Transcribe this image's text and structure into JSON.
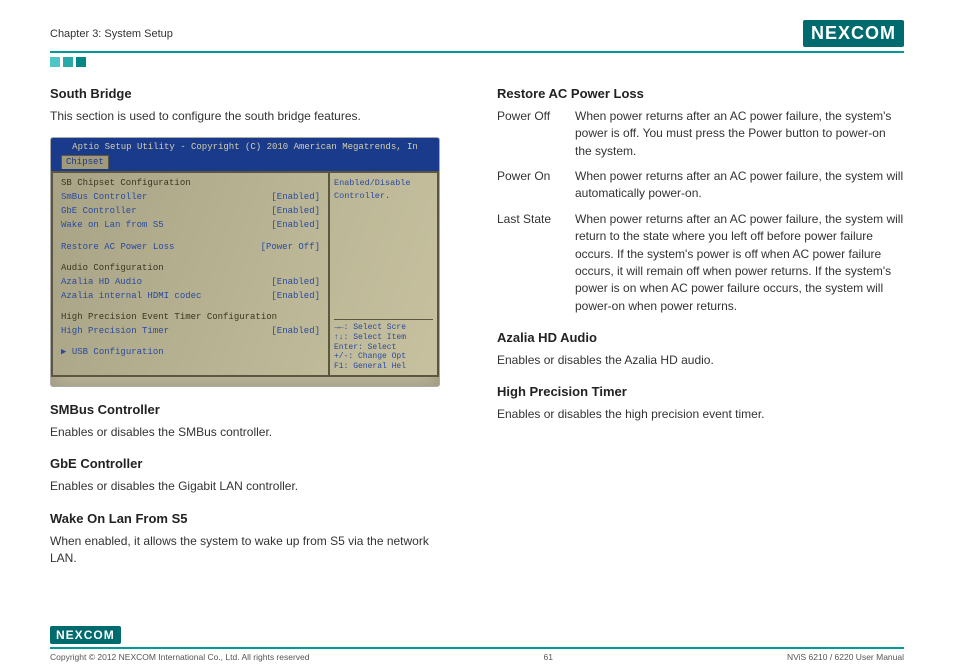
{
  "header": {
    "chapter": "Chapter 3: System Setup",
    "logo_text": "NEXCOM"
  },
  "left": {
    "south_bridge_head": "South Bridge",
    "south_bridge_desc": "This section is used to configure the south bridge features.",
    "smbus_head": "SMBus Controller",
    "smbus_desc": "Enables or disables the SMBus controller.",
    "gbe_head": "GbE Controller",
    "gbe_desc": "Enables or disables the Gigabit LAN controller.",
    "wol_head": "Wake On Lan From S5",
    "wol_desc": "When enabled, it allows the system to wake up from S5 via the network LAN."
  },
  "right": {
    "restore_head": "Restore AC Power Loss",
    "restore_rows": [
      {
        "term": "Power Off",
        "desc": "When power returns after an AC power failure, the system's power is off. You must press the Power button to power-on the system."
      },
      {
        "term": "Power On",
        "desc": "When power returns after an AC power failure, the system will automatically power-on."
      },
      {
        "term": "Last State",
        "desc": "When power returns after an AC power failure, the system will return to the state where you left off before power failure occurs. If the system's power is off when AC power failure occurs, it will remain off when power returns. If the system's power is on when AC power failure occurs, the system will power-on when power returns."
      }
    ],
    "azalia_head": "Azalia HD Audio",
    "azalia_desc": "Enables or disables the Azalia HD audio.",
    "hpet_head": "High Precision Timer",
    "hpet_desc": "Enables or disables the high precision event timer."
  },
  "bios": {
    "title": "Aptio Setup Utility - Copyright (C) 2010 American Megatrends, In",
    "tab": "Chipset",
    "section1": "SB Chipset Configuration",
    "rows1": [
      {
        "label": "SmBus Controller",
        "value": "[Enabled]"
      },
      {
        "label": "GbE Controller",
        "value": "[Enabled]"
      },
      {
        "label": "Wake on Lan from S5",
        "value": "[Enabled]"
      }
    ],
    "rows2": [
      {
        "label": "Restore AC Power Loss",
        "value": "[Power Off]"
      }
    ],
    "section2": "Audio Configuration",
    "rows3": [
      {
        "label": "Azalia HD Audio",
        "value": "[Enabled]"
      },
      {
        "label": "Azalia internal HDMI codec",
        "value": "[Enabled]"
      }
    ],
    "section3": "High Precision Event Timer Configuration",
    "rows4": [
      {
        "label": "High Precision Timer",
        "value": "[Enabled]"
      }
    ],
    "usb": "▶ USB Configuration",
    "right_desc": "Enabled/Disable Controller.",
    "help": [
      "→←: Select Scre",
      "↑↓: Select Item",
      "Enter: Select",
      "+/-: Change Opt",
      "F1: General Hel"
    ]
  },
  "footer": {
    "copyright": "Copyright © 2012 NEXCOM International Co., Ltd. All rights reserved",
    "page": "61",
    "manual": "NViS 6210 / 6220 User Manual",
    "logo_text": "NEXCOM"
  }
}
